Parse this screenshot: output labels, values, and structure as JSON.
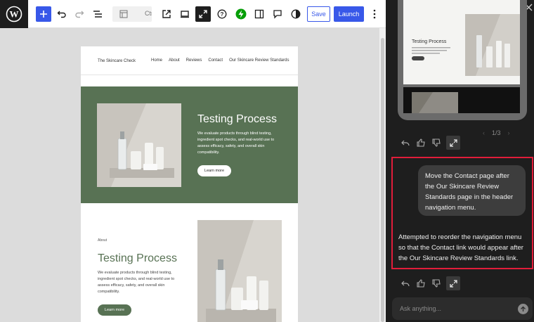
{
  "toolbar": {
    "doc_bar_text": "Ctr",
    "save_label": "Save",
    "launch_label": "Launch",
    "icons": [
      "wordpress-icon",
      "plus-icon",
      "undo-icon",
      "redo-icon",
      "list-view-icon",
      "template-icon",
      "external-link-icon",
      "desktop-icon",
      "fullscreen-icon",
      "help-icon",
      "bolt-icon",
      "sidebar-icon",
      "comment-icon",
      "contrast-icon",
      "more-vertical-icon"
    ]
  },
  "site": {
    "title": "The Skincare Check",
    "nav": [
      "Home",
      "About",
      "Reviews",
      "Contact",
      "Our Skincare Review Standards"
    ]
  },
  "hero": {
    "title": "Testing Process",
    "text": "We evaluate products through blind testing, ingredient spot checks, and real-world use to assess efficacy, safety, and overall skin compatibility.",
    "button": "Learn more"
  },
  "about": {
    "label": "About",
    "title": "Testing Process",
    "text": "We evaluate products through blind testing, ingredient spot checks, and real-world use to assess efficacy, safety, and overall skin compatibility.",
    "button": "Learn more"
  },
  "panel": {
    "preview_title": "Testing Process",
    "pager": "1/3",
    "user_message": "Move the Contact page after the Our Skincare Review Standards page in the header navigation menu.",
    "ai_message": "Attempted to reorder the navigation menu so that the Contact link would appear after the Our Skincare Review Standards link.",
    "input_placeholder": "Ask anything...",
    "highlight_color": "#e11d3a"
  },
  "colors": {
    "accent": "#3858e9",
    "hero_green": "#587254",
    "panel_bg": "#1e1e1e"
  }
}
